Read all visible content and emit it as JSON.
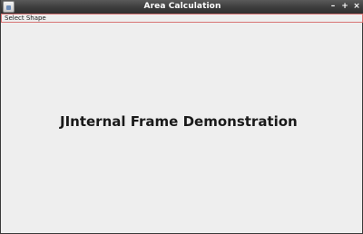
{
  "window": {
    "title": "Area Calculation",
    "controls": {
      "minimize": "–",
      "maximize": "+",
      "close": "×"
    }
  },
  "menubar": {
    "items": [
      {
        "label": "Select Shape"
      }
    ]
  },
  "desktop": {
    "heading": "JInternal Frame Demonstration"
  }
}
